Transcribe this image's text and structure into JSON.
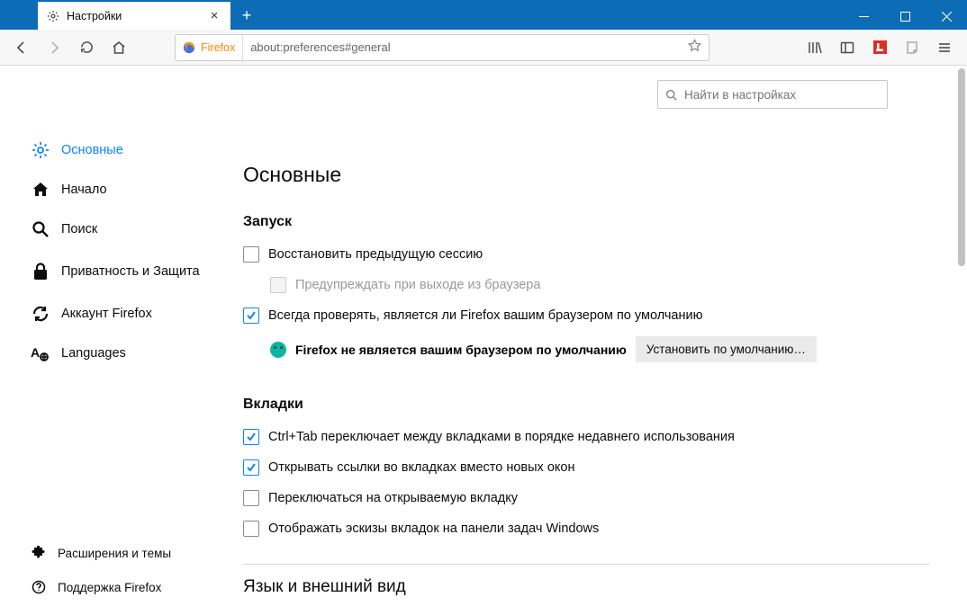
{
  "tab": {
    "title": "Настройки"
  },
  "urlbar": {
    "identity": "Firefox",
    "url": "about:preferences#general"
  },
  "search": {
    "placeholder": "Найти в настройках"
  },
  "sidebar": {
    "items": [
      {
        "label": "Основные"
      },
      {
        "label": "Начало"
      },
      {
        "label": "Поиск"
      },
      {
        "label": "Приватность и Защита"
      },
      {
        "label": "Аккаунт Firefox"
      },
      {
        "label": "Languages"
      }
    ],
    "bottom": [
      {
        "label": "Расширения и темы"
      },
      {
        "label": "Поддержка Firefox"
      }
    ]
  },
  "main": {
    "title": "Основные",
    "startup": {
      "heading": "Запуск",
      "restore": "Восстановить предыдущую сессию",
      "warn": "Предупреждать при выходе из браузера",
      "always_check": "Всегда проверять, является ли Firefox вашим браузером по умолчанию",
      "not_default": "Firefox не является вашим браузером по умолчанию",
      "set_default_btn": "Установить по умолчанию…"
    },
    "tabs": {
      "heading": "Вкладки",
      "ctrltab": "Ctrl+Tab переключает между вкладками в порядке недавнего использования",
      "open_links": "Открывать ссылки во вкладках вместо новых окон",
      "switch": "Переключаться на открываемую вкладку",
      "thumbs": "Отображать эскизы вкладок на панели задач Windows"
    },
    "lang_heading": "Язык и внешний вид"
  }
}
